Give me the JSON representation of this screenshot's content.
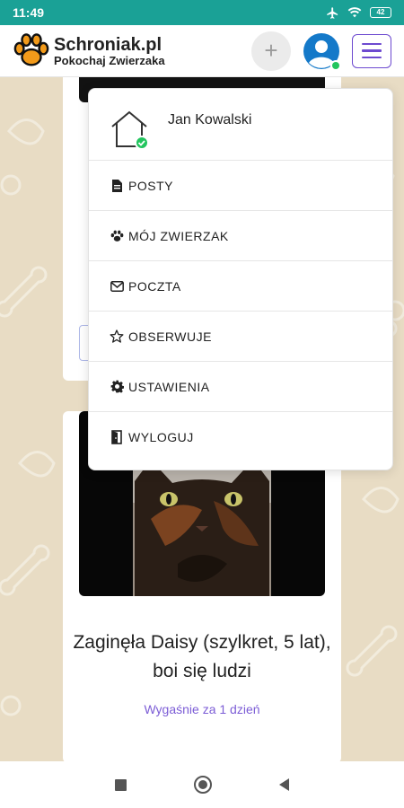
{
  "status_bar": {
    "time": "11:49",
    "battery": "42",
    "icons": [
      "airplane-icon",
      "wifi-icon",
      "battery-icon"
    ]
  },
  "header": {
    "logo_title": "Schroniak.pl",
    "logo_subtitle": "Pokochaj Zwierzaka",
    "add_label": "+",
    "colors": {
      "accent": "#6d4ad0",
      "status_bar": "#1aa196",
      "online": "#22c55e"
    }
  },
  "user_menu": {
    "user_name": "Jan Kowalski",
    "items": [
      {
        "label": "POSTY",
        "icon": "document-icon"
      },
      {
        "label": "MÓJ ZWIERZAK",
        "icon": "paw-icon"
      },
      {
        "label": "POCZTA",
        "icon": "envelope-icon"
      },
      {
        "label": "OBSERWUJE",
        "icon": "star-icon"
      },
      {
        "label": "USTAWIENIA",
        "icon": "gear-icon"
      },
      {
        "label": "WYLOGUJ",
        "icon": "door-icon"
      }
    ]
  },
  "feed": {
    "post": {
      "title": "Zaginęła Daisy (szylkret, 5 lat), boi się ludzi",
      "expiry": "Wygaśnie za 1 dzień"
    }
  }
}
